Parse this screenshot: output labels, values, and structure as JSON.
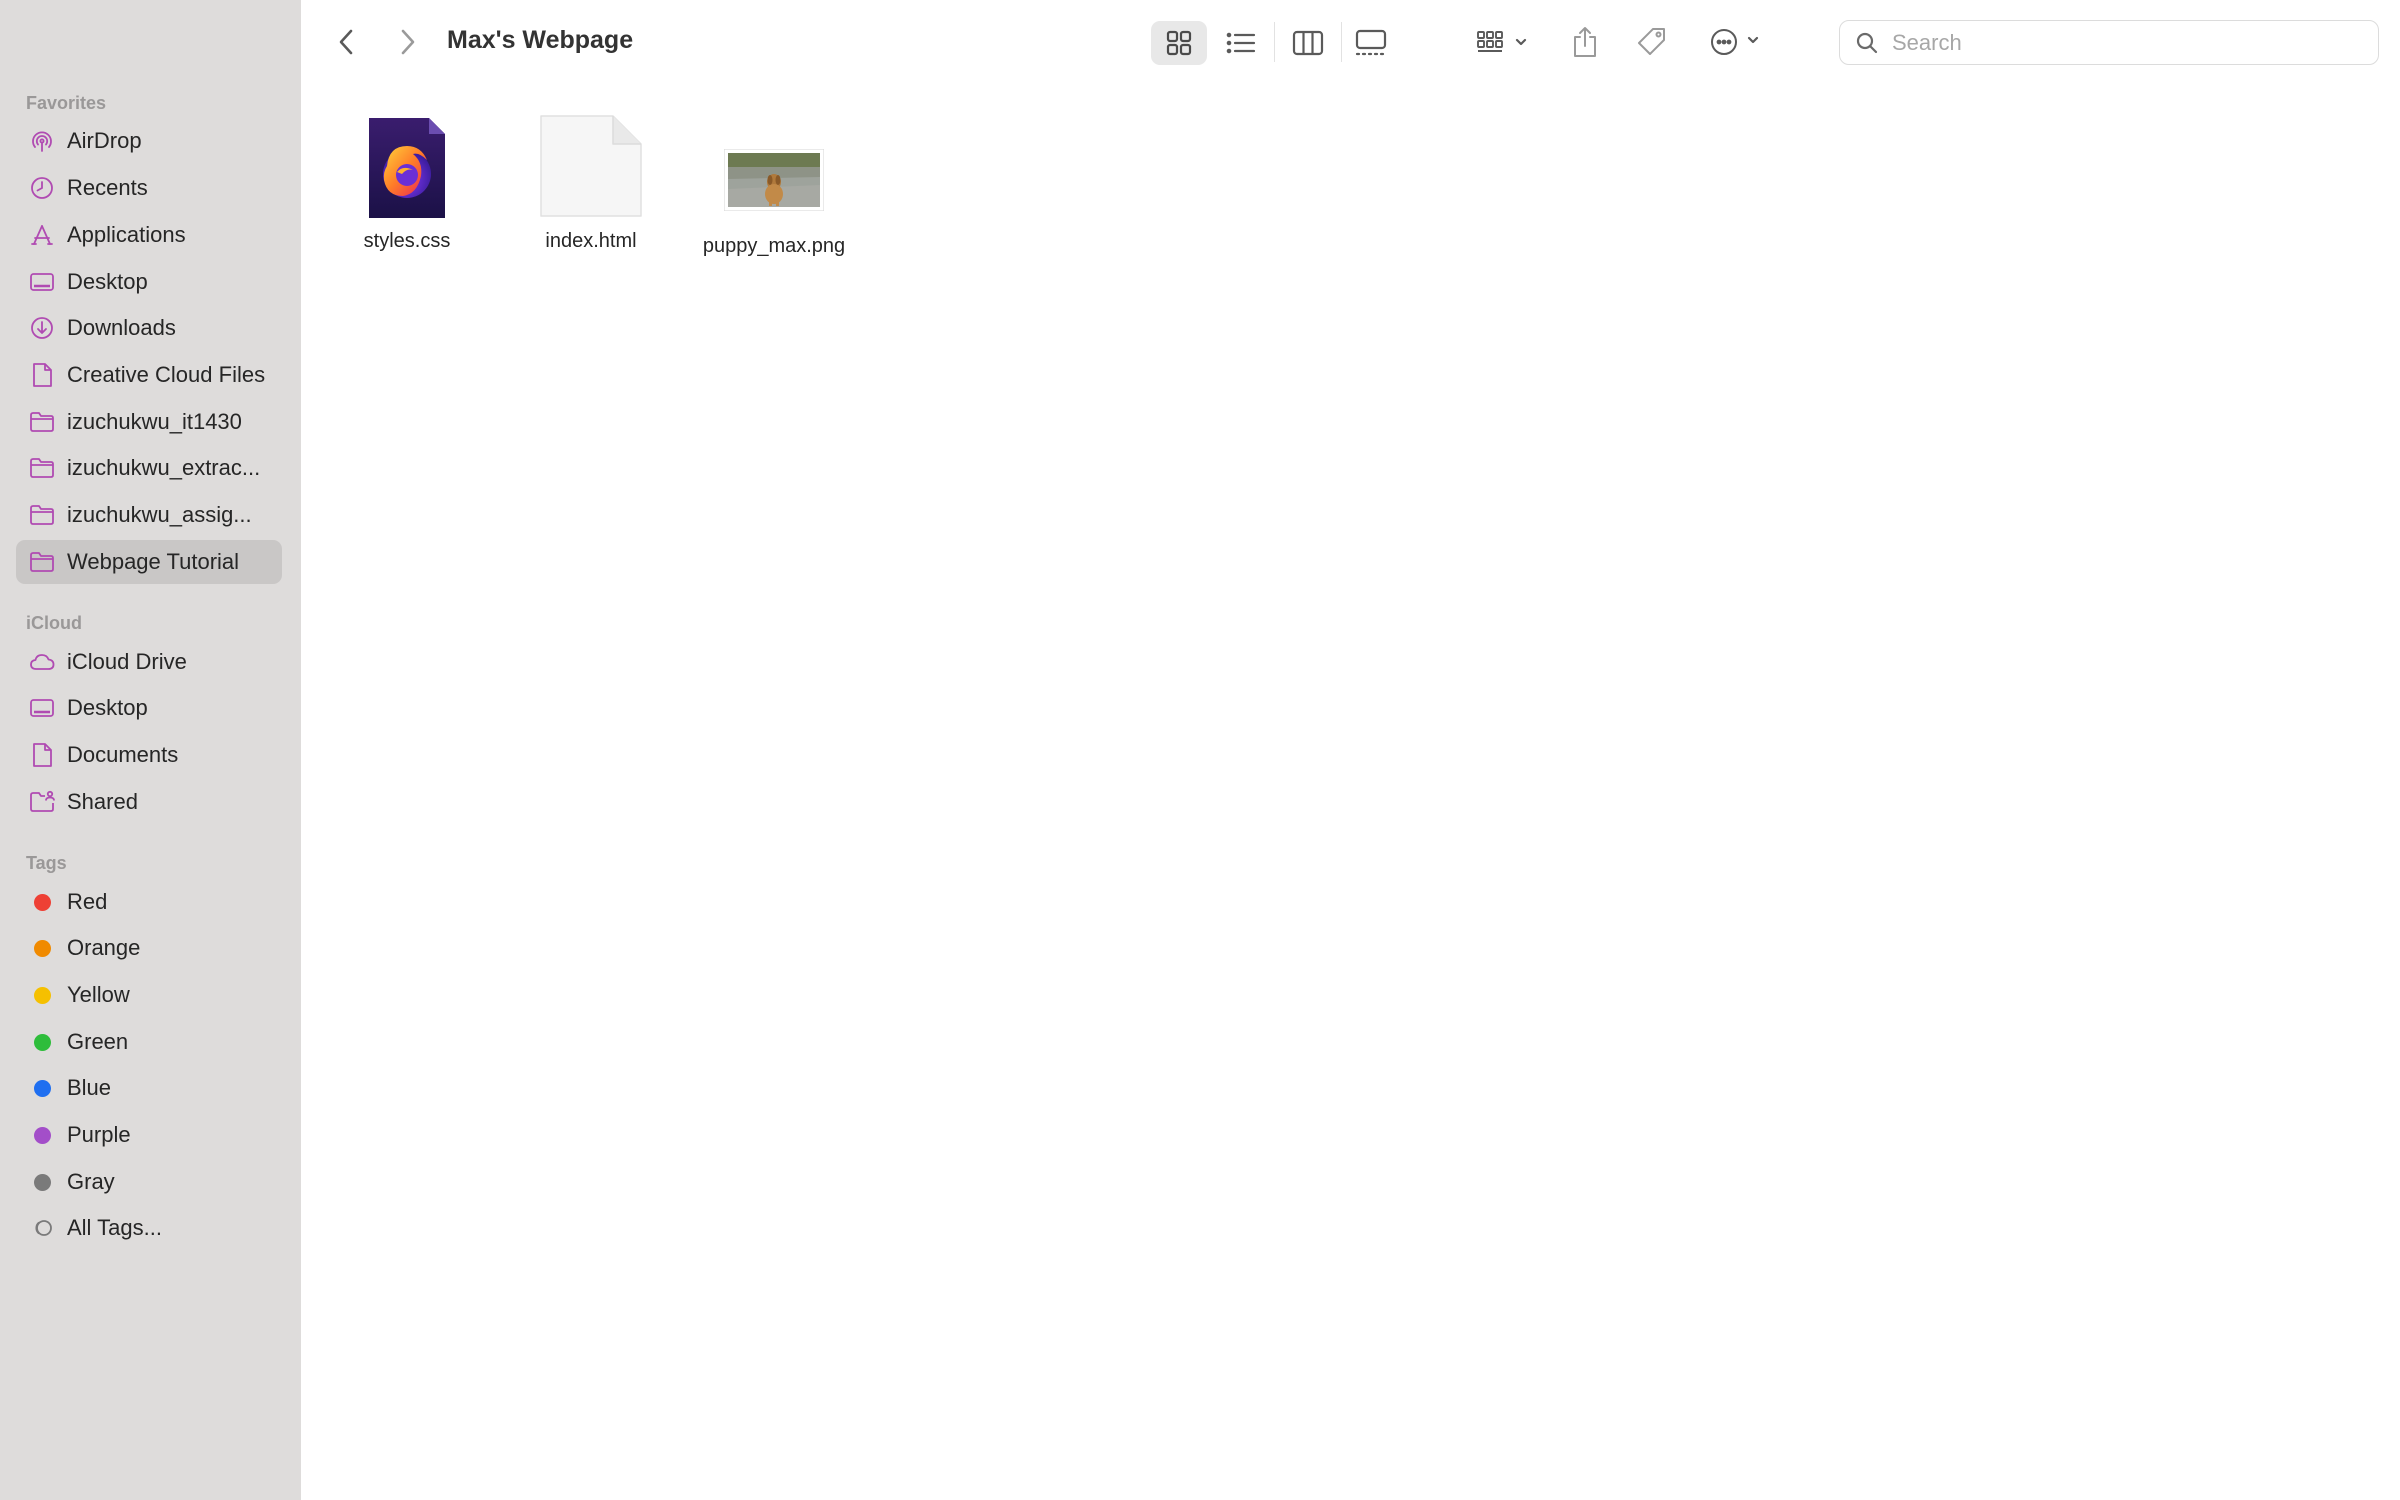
{
  "window": {
    "title": "Max's Webpage"
  },
  "sidebar": {
    "favorites_title": "Favorites",
    "favorites": [
      {
        "label": "AirDrop",
        "icon": "airdrop-icon"
      },
      {
        "label": "Recents",
        "icon": "clock-icon"
      },
      {
        "label": "Applications",
        "icon": "applications-icon"
      },
      {
        "label": "Desktop",
        "icon": "desktop-icon"
      },
      {
        "label": "Downloads",
        "icon": "download-icon"
      },
      {
        "label": "Creative Cloud Files",
        "icon": "document-icon"
      },
      {
        "label": "izuchukwu_it1430",
        "icon": "folder-icon"
      },
      {
        "label": "izuchukwu_extrac...",
        "icon": "folder-icon"
      },
      {
        "label": "izuchukwu_assig...",
        "icon": "folder-icon"
      },
      {
        "label": "Webpage Tutorial",
        "icon": "folder-icon",
        "selected": true
      }
    ],
    "icloud_title": "iCloud",
    "icloud": [
      {
        "label": "iCloud Drive",
        "icon": "cloud-icon"
      },
      {
        "label": "Desktop",
        "icon": "desktop-icon"
      },
      {
        "label": "Documents",
        "icon": "document-icon"
      },
      {
        "label": "Shared",
        "icon": "shared-folder-icon"
      }
    ],
    "tags_title": "Tags",
    "tags": [
      {
        "label": "Red",
        "color": "#ee4035"
      },
      {
        "label": "Orange",
        "color": "#f08a00"
      },
      {
        "label": "Yellow",
        "color": "#f5c000"
      },
      {
        "label": "Green",
        "color": "#2ebd3b"
      },
      {
        "label": "Blue",
        "color": "#1f6ff0"
      },
      {
        "label": "Purple",
        "color": "#a34ec9"
      },
      {
        "label": "Gray",
        "color": "#7a7a7a"
      },
      {
        "label": "All Tags...",
        "icon": "all-tags-icon"
      }
    ]
  },
  "toolbar": {
    "search_placeholder": "Search",
    "view_mode": "icon",
    "buttons": [
      "back-icon",
      "forward-icon",
      "icon-view-icon",
      "list-view-icon",
      "column-view-icon",
      "gallery-view-icon",
      "group-icon",
      "share-icon",
      "tag-icon",
      "more-icon"
    ]
  },
  "files": [
    {
      "name": "styles.css",
      "icon": "firefox-document-icon"
    },
    {
      "name": "index.html",
      "icon": "blank-document-icon"
    },
    {
      "name": "puppy_max.png",
      "icon": "image-thumbnail-icon"
    }
  ],
  "colors": {
    "accent": "#b04bb2",
    "sidebar_bg": "#dedcdb",
    "selection_bg": "#c9c7c6"
  }
}
